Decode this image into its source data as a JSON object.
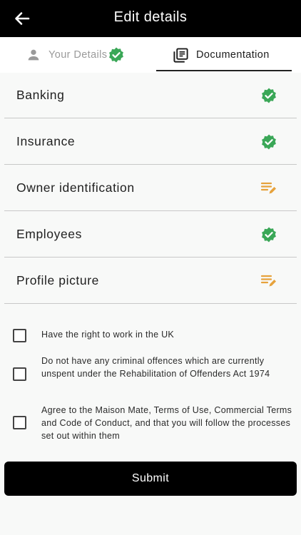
{
  "header": {
    "title": "Edit details",
    "back_icon": "arrow-left-icon"
  },
  "tabs": [
    {
      "label": "Your Details",
      "icon": "person-icon",
      "status_icon": "verified-badge-icon",
      "active": false
    },
    {
      "label": "Documentation",
      "icon": "library-books-icon",
      "active": true
    }
  ],
  "documents": [
    {
      "label": "Banking",
      "status": "complete",
      "status_icon": "verified-badge-icon"
    },
    {
      "label": "Insurance",
      "status": "complete",
      "status_icon": "verified-badge-icon"
    },
    {
      "label": "Owner identification",
      "status": "pending",
      "status_icon": "edit-note-icon"
    },
    {
      "label": "Employees",
      "status": "complete",
      "status_icon": "verified-badge-icon"
    },
    {
      "label": "Profile picture",
      "status": "pending",
      "status_icon": "edit-note-icon"
    }
  ],
  "agreements": [
    {
      "text": "Have the right to work in the UK",
      "checked": false
    },
    {
      "text": "Do not have any criminal offences which are currently unspent under the Rehabilitation of Offenders Act 1974",
      "checked": false
    },
    {
      "text": "Agree to the Maison Mate, Terms of Use, Commercial Terms and Code of Conduct, and that you will follow the processes set out within them",
      "checked": false
    }
  ],
  "submit": {
    "label": "Submit"
  },
  "colors": {
    "complete": "#3aa757",
    "pending": "#e6a23c",
    "appbar": "#000000",
    "button": "#000000"
  }
}
